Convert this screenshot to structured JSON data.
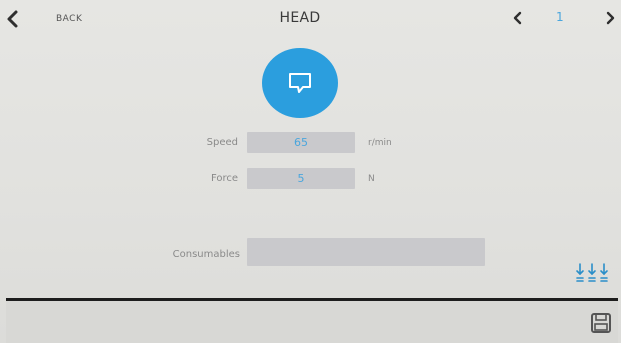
{
  "header": {
    "back_label": "BACK",
    "title": "HEAD",
    "page_number": "1"
  },
  "main": {
    "speed": {
      "label": "Speed",
      "value": "65",
      "unit": "r/min"
    },
    "force": {
      "label": "Force",
      "value": "5",
      "unit": "N"
    },
    "consumables": {
      "label": "Consumables",
      "value": ""
    }
  },
  "icons": {
    "back": "chevron-left-icon",
    "prev": "chevron-left-icon",
    "next": "chevron-right-icon",
    "head": "head-icon",
    "tools": "tool-adjust-icon",
    "save": "save-icon"
  },
  "colors": {
    "accent": "#2b9ede",
    "value_text": "#4aa6dd",
    "field_bg": "#c9c9cc",
    "divider": "#1d1d1d"
  }
}
